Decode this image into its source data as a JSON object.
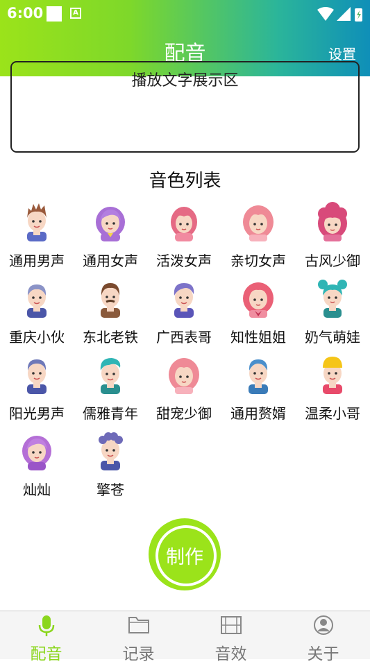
{
  "status": {
    "time": "6:00",
    "a_icon": "A"
  },
  "header": {
    "title": "配音",
    "settings_label": "设置",
    "gradient": [
      "#9be31a",
      "#0f8fb8"
    ]
  },
  "text_area": {
    "placeholder": "播放文字展示区"
  },
  "voice_list": {
    "title": "音色列表",
    "items": [
      {
        "label": "通用男声",
        "icon": "man-brown-spiky-hair-avatar"
      },
      {
        "label": "通用女声",
        "icon": "woman-purple-hair-avatar"
      },
      {
        "label": "活泼女声",
        "icon": "girl-pink-hair-avatar"
      },
      {
        "label": "亲切女声",
        "icon": "woman-pink-long-hair-avatar"
      },
      {
        "label": "古风少御",
        "icon": "woman-magenta-curly-hair-avatar"
      },
      {
        "label": "重庆小伙",
        "icon": "man-grey-hair-avatar"
      },
      {
        "label": "东北老铁",
        "icon": "man-brown-hair-mustache-avatar"
      },
      {
        "label": "广西表哥",
        "icon": "man-purple-hair-avatar"
      },
      {
        "label": "知性姐姐",
        "icon": "woman-pink-bow-avatar"
      },
      {
        "label": "奶气萌娃",
        "icon": "girl-teal-buns-avatar"
      },
      {
        "label": "阳光男声",
        "icon": "man-slate-hair-avatar"
      },
      {
        "label": "儒雅青年",
        "icon": "man-teal-hair-avatar"
      },
      {
        "label": "甜宠少御",
        "icon": "woman-pink-long-hair-avatar"
      },
      {
        "label": "通用赘婿",
        "icon": "man-blue-hair-avatar"
      },
      {
        "label": "温柔小哥",
        "icon": "boy-yellow-hat-avatar"
      },
      {
        "label": "灿灿",
        "icon": "girl-purple-hair-avatar"
      },
      {
        "label": "擎苍",
        "icon": "man-curly-purple-hair-avatar"
      }
    ]
  },
  "make_button": {
    "label": "制作",
    "color": "#9be31a"
  },
  "tabbar": {
    "active_color": "#8bd61d",
    "tabs": [
      {
        "label": "配音",
        "icon": "microphone-icon",
        "active": true
      },
      {
        "label": "记录",
        "icon": "folder-icon",
        "active": false
      },
      {
        "label": "音效",
        "icon": "film-icon",
        "active": false
      },
      {
        "label": "关于",
        "icon": "user-circle-icon",
        "active": false
      }
    ]
  }
}
